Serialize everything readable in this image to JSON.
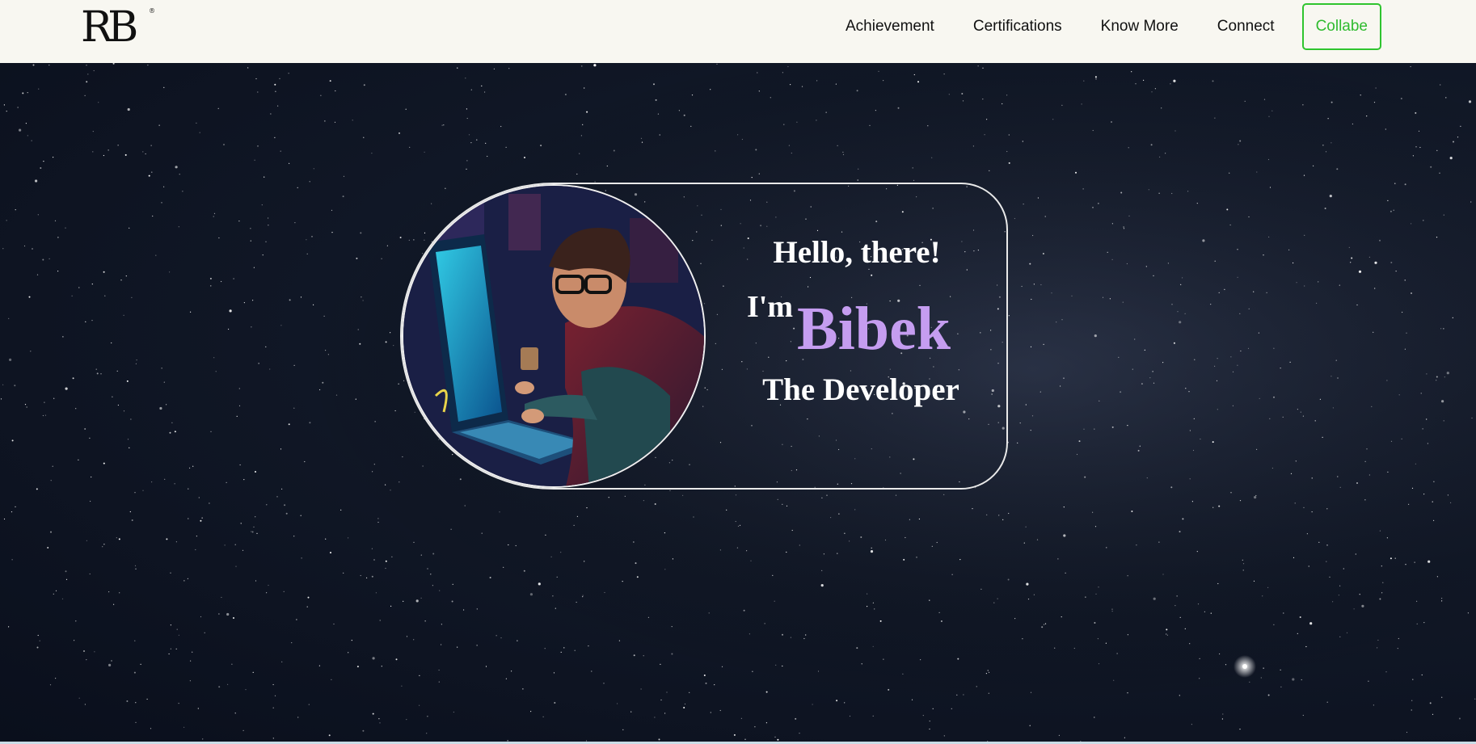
{
  "header": {
    "logo_text": "RB",
    "nav": [
      {
        "label": "Achievement"
      },
      {
        "label": "Certifications"
      },
      {
        "label": "Know More"
      },
      {
        "label": "Connect"
      }
    ],
    "cta_label": "Collabe"
  },
  "hero": {
    "greeting": "Hello, there!",
    "intro": "I'm",
    "name": "Bibek",
    "role": "The Developer"
  },
  "colors": {
    "accent_name": "#c59df0",
    "cta_green": "#2fc42f",
    "navbar_bg": "#f8f7f1",
    "hero_bg": "#111827"
  }
}
